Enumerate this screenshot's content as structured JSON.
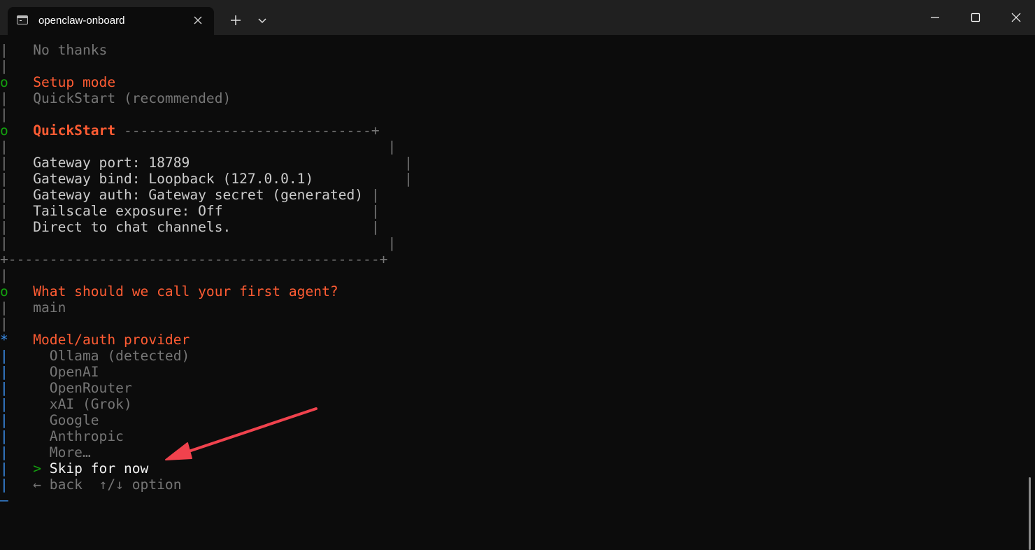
{
  "window": {
    "tab_title": "openclaw-onboard"
  },
  "icons": {
    "tab_icon": "terminal-icon",
    "close": "close-icon",
    "new_tab": "plus-icon",
    "dropdown": "chevron-down-icon",
    "minimize": "minimize-icon",
    "maximize": "maximize-icon",
    "window_close": "window-close-icon"
  },
  "colors": {
    "background": "#0c0c0c",
    "titlebar": "#202020",
    "heading_orange": "#ff5c33",
    "done_green": "#13a10e",
    "active_blue": "#3b8eea",
    "dim_gray": "#767676",
    "text": "#cccccc",
    "annotation_arrow": "#f0424d"
  },
  "terminal": {
    "no_thanks": "No thanks",
    "setup_mode": {
      "marker": "o",
      "heading": "Setup mode",
      "value": "QuickStart (recommended)"
    },
    "quickstart": {
      "marker": "o",
      "heading": "QuickStart",
      "heading_rule": "------------------------------+",
      "lines": [
        "Gateway port: 18789",
        "Gateway bind: Loopback (127.0.0.1)",
        "Gateway auth: Gateway secret (generated)",
        "Tailscale exposure: Off",
        "Direct to chat channels."
      ],
      "bottom_rule": "+---------------------------------------------+"
    },
    "agent": {
      "marker": "o",
      "heading": "What should we call your first agent?",
      "value": "main"
    },
    "provider": {
      "marker": "*",
      "heading": "Model/auth provider",
      "options": [
        "Ollama (detected)",
        "OpenAI",
        "OpenRouter",
        "xAI (Grok)",
        "Google",
        "Anthropic",
        "More…"
      ],
      "selected_pointer": ">",
      "selected": "Skip for now",
      "hint_back": "← back",
      "hint_option": "↑/↓ option"
    },
    "bar": "|",
    "end": "—"
  }
}
